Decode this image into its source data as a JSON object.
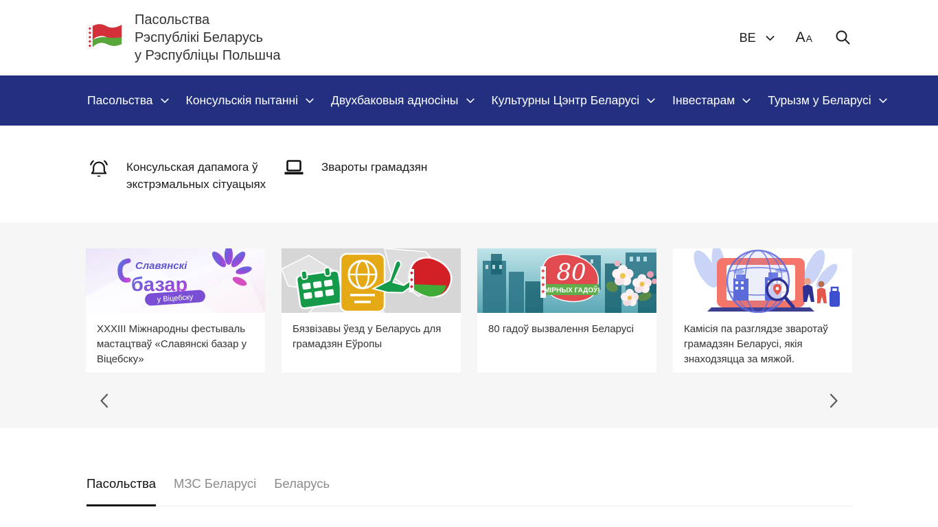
{
  "header": {
    "logo_alt": "Flag of the Republic of Belarus",
    "title_lines": [
      "Пасольства",
      "Рэспублікі Беларусь",
      "у Рэспубліцы Польшча"
    ],
    "language_code": "BE",
    "font_size_large": "A",
    "font_size_small": "A"
  },
  "nav": {
    "items": [
      {
        "label": "Пасольства"
      },
      {
        "label": "Консульскія пытанні"
      },
      {
        "label": "Двухбаковыя адносіны"
      },
      {
        "label": "Культурны Цэнтр Беларусі"
      },
      {
        "label": "Інвестарам"
      },
      {
        "label": "Турызм у Беларусі"
      }
    ]
  },
  "quick_links": {
    "items": [
      {
        "label": "Консульская дапамога ў экстрэмальных сітуацыях",
        "icon": "bell-icon"
      },
      {
        "label": "Звароты грамадзян",
        "icon": "laptop-icon"
      }
    ]
  },
  "carousel": {
    "cards": [
      {
        "title": "XXXIII Міжнародны фестываль мастацтваў «Славянскі базар у Віцебску»",
        "image": {
          "alt": "Slavianski Bazaar in Vitebsk festival logo",
          "label_top": "Славянскі",
          "label_main": "базар",
          "label_badge": "у Віцебску"
        }
      },
      {
        "title": "Бязвізавы ўезд у Беларусь для грамадзян Еўропы",
        "image": {
          "alt": "Calendar, passport, airplane and Belarus map on grey map background"
        }
      },
      {
        "title": "80 гадоў вызвалення Беларусі",
        "image": {
          "alt": "Ruined city in teal, red Belarus shape and apple blossoms",
          "label_top": "80",
          "label_band": "МІРНЫХ ГАДОЎ!"
        }
      },
      {
        "title": "Камісія па разглядзе зваротаў грамадзян Беларусі, якія знаходзяцца за мяжой.",
        "image": {
          "alt": "Laptop with globe, buildings, magnifier and people illustration"
        }
      }
    ]
  },
  "tabs": {
    "items": [
      {
        "label": "Пасольства",
        "active": true
      },
      {
        "label": "МЗС Беларусі",
        "active": false
      },
      {
        "label": "Беларусь",
        "active": false
      }
    ]
  },
  "colors": {
    "nav_background": "#22307f",
    "strip_background": "#f6f6f6",
    "card_background": "#ffffff",
    "text_primary": "#333333",
    "tab_inactive": "#8c8c8c"
  }
}
